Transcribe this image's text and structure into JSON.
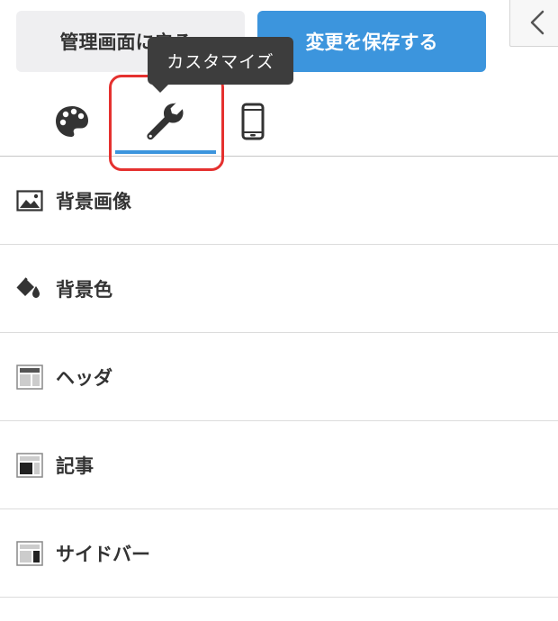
{
  "header": {
    "back_label": "管理画面に戻る",
    "save_label": "変更を保存する"
  },
  "tooltip": {
    "text": "カスタマイズ"
  },
  "tabs": [
    {
      "icon": "palette-icon",
      "active": false
    },
    {
      "icon": "wrench-icon",
      "active": true
    },
    {
      "icon": "smartphone-icon",
      "active": false
    }
  ],
  "menu": {
    "items": [
      {
        "label": "背景画像",
        "icon": "image-icon"
      },
      {
        "label": "背景色",
        "icon": "paint-bucket-icon"
      },
      {
        "label": "ヘッダ",
        "icon": "layout-header-icon"
      },
      {
        "label": "記事",
        "icon": "layout-article-icon"
      },
      {
        "label": "サイドバー",
        "icon": "layout-sidebar-icon"
      }
    ]
  },
  "colors": {
    "accent": "#3c95dd",
    "highlight": "#e5312f",
    "tooltip_bg": "#3d3d3d"
  }
}
